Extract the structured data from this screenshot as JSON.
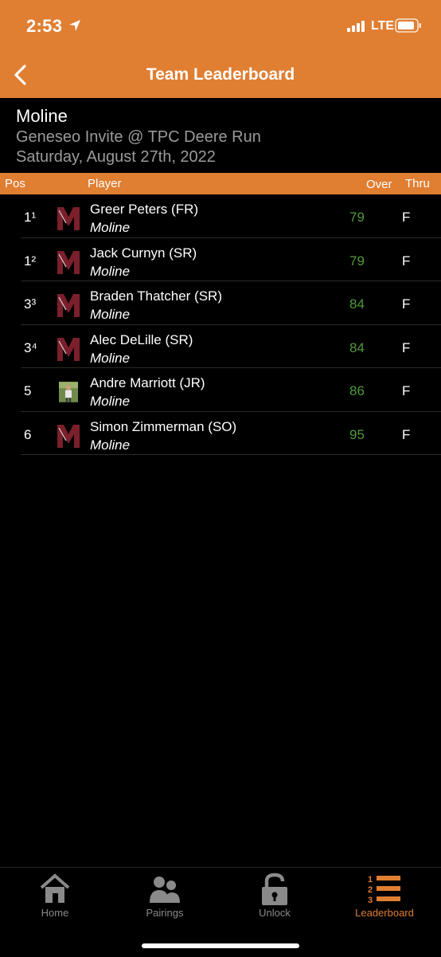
{
  "status_bar": {
    "time": "2:53",
    "network": "LTE"
  },
  "nav": {
    "title": "Team Leaderboard"
  },
  "team": {
    "name": "Moline",
    "event": "Geneseo Invite @ TPC Deere Run",
    "date": "Saturday, August 27th, 2022"
  },
  "columns": {
    "pos": "Pos",
    "player": "Player",
    "over": "Over",
    "thru": "Thru"
  },
  "players": [
    {
      "pos": "1¹",
      "name": "Greer Peters (FR)",
      "team": "Moline",
      "score": "79",
      "thru": "F",
      "avatar": "moline-logo"
    },
    {
      "pos": "1²",
      "name": "Jack Curnyn (SR)",
      "team": "Moline",
      "score": "79",
      "thru": "F",
      "avatar": "moline-logo"
    },
    {
      "pos": "3³",
      "name": "Braden Thatcher (SR)",
      "team": "Moline",
      "score": "84",
      "thru": "F",
      "avatar": "moline-logo"
    },
    {
      "pos": "3⁴",
      "name": "Alec DeLille (SR)",
      "team": "Moline",
      "score": "84",
      "thru": "F",
      "avatar": "moline-logo"
    },
    {
      "pos": "5",
      "name": "Andre Marriott (JR)",
      "team": "Moline",
      "score": "86",
      "thru": "F",
      "avatar": "player-photo"
    },
    {
      "pos": "6",
      "name": "Simon Zimmerman (SO)",
      "team": "Moline",
      "score": "95",
      "thru": "F",
      "avatar": "moline-logo"
    }
  ],
  "tabs": [
    {
      "label": "Home",
      "icon": "home-icon"
    },
    {
      "label": "Pairings",
      "icon": "pairings-icon"
    },
    {
      "label": "Unlock",
      "icon": "unlock-icon"
    },
    {
      "label": "Leaderboard",
      "icon": "leaderboard-icon",
      "active": true
    }
  ],
  "colors": {
    "accent": "#E07E32",
    "score_green": "#4f9a3a",
    "logo_maroon": "#7a1f2b"
  }
}
